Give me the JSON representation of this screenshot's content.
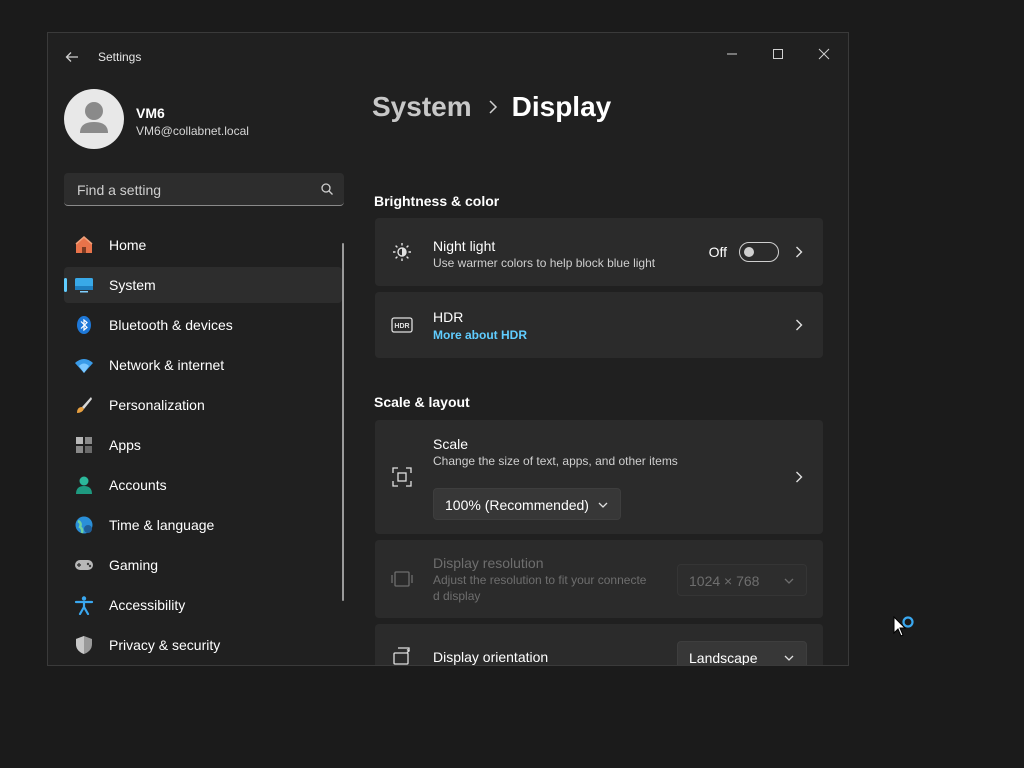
{
  "window": {
    "title": "Settings",
    "controls": {
      "minimize": "minimize-icon",
      "maximize": "maximize-icon",
      "close": "close-icon"
    }
  },
  "user": {
    "name": "VM6",
    "email": "VM6@collabnet.local"
  },
  "search": {
    "placeholder": "Find a setting"
  },
  "sidebar": {
    "items": [
      {
        "label": "Home",
        "icon": "home-icon"
      },
      {
        "label": "System",
        "icon": "system-icon",
        "active": true
      },
      {
        "label": "Bluetooth & devices",
        "icon": "bluetooth-icon"
      },
      {
        "label": "Network & internet",
        "icon": "wifi-icon"
      },
      {
        "label": "Personalization",
        "icon": "brush-icon"
      },
      {
        "label": "Apps",
        "icon": "apps-icon"
      },
      {
        "label": "Accounts",
        "icon": "accounts-icon"
      },
      {
        "label": "Time & language",
        "icon": "globe-icon"
      },
      {
        "label": "Gaming",
        "icon": "gamepad-icon"
      },
      {
        "label": "Accessibility",
        "icon": "accessibility-icon"
      },
      {
        "label": "Privacy & security",
        "icon": "shield-icon"
      }
    ]
  },
  "breadcrumb": {
    "parent": "System",
    "current": "Display"
  },
  "sections": {
    "brightness": {
      "title": "Brightness & color",
      "night_light": {
        "title": "Night light",
        "desc": "Use warmer colors to help block blue light",
        "state": "Off"
      },
      "hdr": {
        "title": "HDR",
        "link": "More about HDR"
      }
    },
    "scale_layout": {
      "title": "Scale & layout",
      "scale": {
        "title": "Scale",
        "desc": "Change the size of text, apps, and other items",
        "value": "100% (Recommended)"
      },
      "resolution": {
        "title": "Display resolution",
        "desc_line1": "Adjust the resolution to fit your connecte",
        "desc_line2": "d display",
        "value": "1024 × 768"
      },
      "orientation": {
        "title": "Display orientation",
        "value": "Landscape"
      }
    }
  },
  "colors": {
    "accent": "#60cdff",
    "background": "#202020",
    "card": "#2b2b2b"
  }
}
